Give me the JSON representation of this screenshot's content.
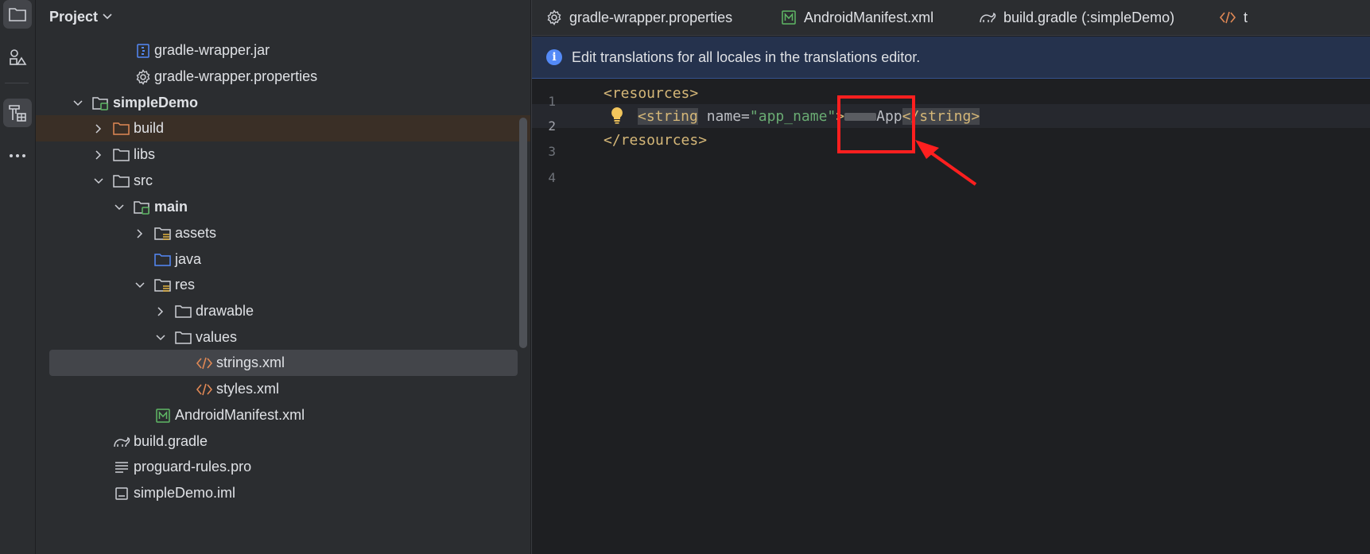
{
  "project_panel": {
    "title": "Project",
    "tree": [
      {
        "label": "gradle-wrapper.jar",
        "icon": "jar-file-icon"
      },
      {
        "label": "gradle-wrapper.properties",
        "icon": "gear-icon"
      },
      {
        "label": "simpleDemo",
        "icon": "module-folder-icon",
        "expanded": true
      },
      {
        "label": "build",
        "icon": "excluded-folder-icon",
        "expanded": false
      },
      {
        "label": "libs",
        "icon": "folder-icon",
        "expanded": false
      },
      {
        "label": "src",
        "icon": "folder-icon",
        "expanded": true
      },
      {
        "label": "main",
        "icon": "source-root-folder-icon",
        "expanded": true
      },
      {
        "label": "assets",
        "icon": "resource-folder-icon",
        "expanded": false
      },
      {
        "label": "java",
        "icon": "source-folder-icon"
      },
      {
        "label": "res",
        "icon": "resource-folder-icon",
        "expanded": true
      },
      {
        "label": "drawable",
        "icon": "folder-icon",
        "expanded": false
      },
      {
        "label": "values",
        "icon": "folder-icon",
        "expanded": true
      },
      {
        "label": "strings.xml",
        "icon": "xml-file-icon",
        "selected": true
      },
      {
        "label": "styles.xml",
        "icon": "xml-file-icon"
      },
      {
        "label": "AndroidManifest.xml",
        "icon": "manifest-file-icon"
      },
      {
        "label": "build.gradle",
        "icon": "gradle-icon"
      },
      {
        "label": "proguard-rules.pro",
        "icon": "text-file-icon"
      },
      {
        "label": "simpleDemo.iml",
        "icon": "iml-file-icon"
      }
    ]
  },
  "tabs": [
    {
      "label": "gradle-wrapper.properties",
      "icon": "gear-icon"
    },
    {
      "label": "AndroidManifest.xml",
      "icon": "manifest-file-icon"
    },
    {
      "label": "build.gradle (:simpleDemo)",
      "icon": "gradle-icon"
    },
    {
      "label": "t",
      "icon": "xml-file-icon"
    }
  ],
  "banner": {
    "text": "Edit translations for all locales in the translations editor."
  },
  "editor": {
    "line_numbers": [
      "1",
      "2",
      "3",
      "4"
    ],
    "current_line": 2,
    "lines": {
      "l1_tag": "<resources>",
      "l2_open_tag": "<string",
      "l2_attr": " name",
      "l2_eq": "=",
      "l2_val": "\"app_name\"",
      "l2_gt": ">",
      "l2_text_visible": "App",
      "l2_close_tag": "</string>",
      "l3_tag": "</resources>"
    }
  },
  "colors": {
    "annotation_red": "#ff1f1f",
    "tag_color": "#d5b778",
    "value_color": "#6aab73"
  }
}
